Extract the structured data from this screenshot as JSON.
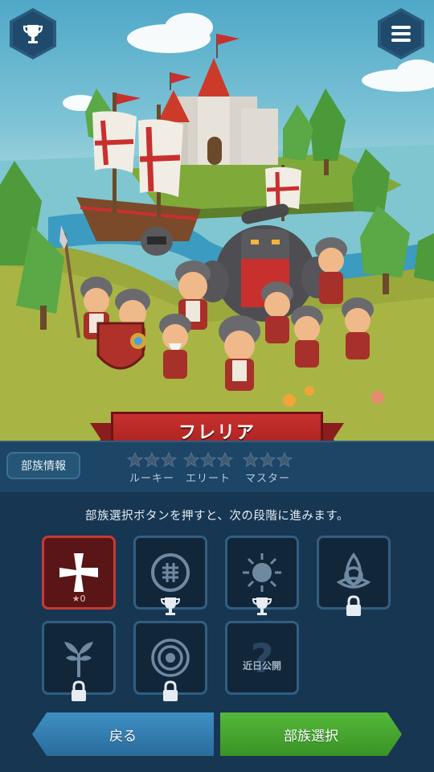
{
  "tribe": {
    "name": "フレリア"
  },
  "info_button_label": "部族情報",
  "ranks": [
    {
      "label": "ルーキー",
      "stars": 3
    },
    {
      "label": "エリート",
      "stars": 3
    },
    {
      "label": "マスター",
      "stars": 3
    }
  ],
  "instruction": "部族選択ボタンを押すと、次の段階に進みます。",
  "tribes": [
    {
      "icon": "cross-emblem-icon",
      "selected": true,
      "star_count": "0"
    },
    {
      "icon": "knot-emblem-icon",
      "badge": "trophy-icon"
    },
    {
      "icon": "sun-emblem-icon",
      "badge": "trophy-icon"
    },
    {
      "icon": "triquetra-emblem-icon",
      "badge": "lock-icon"
    },
    {
      "icon": "tree-emblem-icon",
      "badge": "lock-icon"
    },
    {
      "icon": "ring-emblem-icon",
      "badge": "lock-icon"
    },
    {
      "icon": "question-mark-icon",
      "label": "近日公開"
    }
  ],
  "buttons": {
    "back": "戻る",
    "select": "部族選択"
  },
  "colors": {
    "accent_red": "#c8302e",
    "select_green": "#4aa930",
    "back_blue": "#3a86bb"
  }
}
